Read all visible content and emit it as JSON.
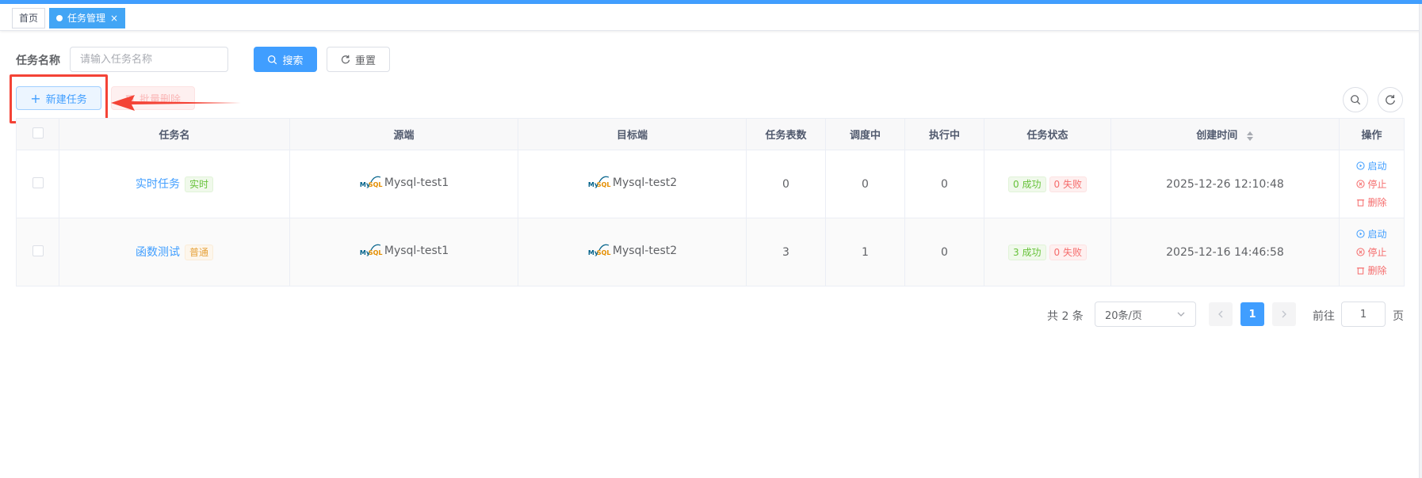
{
  "tabs": {
    "home": "首页",
    "active": "任务管理",
    "close": "×"
  },
  "search": {
    "label": "任务名称",
    "placeholder": "请输入任务名称",
    "search_btn": "搜索",
    "reset_btn": "重置"
  },
  "toolbar": {
    "new_task": "新建任务",
    "batch_delete": "批量删除"
  },
  "table": {
    "headers": [
      "任务名",
      "源端",
      "目标端",
      "任务表数",
      "调度中",
      "执行中",
      "任务状态",
      "创建时间",
      "操作"
    ],
    "rows": [
      {
        "name": "实时任务",
        "tag": "实时",
        "source": "Mysql-test1",
        "target": "Mysql-test2",
        "tables": "0",
        "scheduling": "0",
        "running": "0",
        "success": "0 成功",
        "fail": "0 失败",
        "created": "2025-12-26 12:10:48"
      },
      {
        "name": "函数测试",
        "tag": "普通",
        "source": "Mysql-test1",
        "target": "Mysql-test2",
        "tables": "3",
        "scheduling": "1",
        "running": "0",
        "success": "3 成功",
        "fail": "0 失败",
        "created": "2025-12-16 14:46:58"
      }
    ],
    "ops": {
      "start": "启动",
      "stop": "停止",
      "delete": "删除"
    }
  },
  "db_logo": {
    "my": "My",
    "sql": "SQL"
  },
  "pagination": {
    "total": "共 2 条",
    "page_size": "20条/页",
    "current": "1",
    "goto_label": "前往",
    "goto_value": "1",
    "page_label": "页"
  },
  "colors": {
    "primary": "#409eff",
    "danger": "#f56c6c",
    "success": "#67c23a",
    "warning": "#e6a23c",
    "highlight": "#f44336"
  }
}
